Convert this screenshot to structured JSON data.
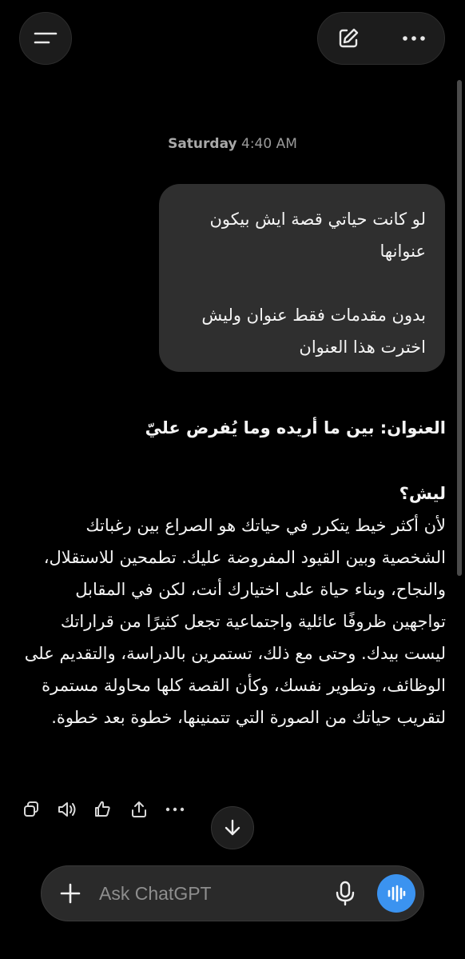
{
  "header": {
    "menu_icon": "menu-icon",
    "new_chat_icon": "new-chat-icon",
    "more_icon": "more-icon"
  },
  "conversation": {
    "timestamp_day": "Saturday",
    "timestamp_time": "4:40 AM",
    "user_message": {
      "paragraph_1": "لو كانت حياتي قصة ايش بيكون عنوانها",
      "paragraph_2": "بدون مقدمات فقط عنوان وليش اخترت هذا العنوان"
    },
    "assistant_message": {
      "title_line": "العنوان: بين ما أريده وما يُفرض عليّ",
      "why_heading": "ليش؟",
      "body": "لأن أكثر خيط يتكرر في حياتك هو الصراع بين رغباتك الشخصية وبين القيود المفروضة عليك. تطمحين للاستقلال، والنجاح، وبناء حياة على اختيارك أنت، لكن في المقابل تواجهين ظروفًا عائلية واجتماعية تجعل كثيرًا من قراراتك ليست بيدك. وحتى مع ذلك، تستمرين بالدراسة، والتقديم على الوظائف، وتطوير نفسك، وكأن القصة كلها محاولة مستمرة لتقريب حياتك من الصورة التي تتمنينها، خطوة بعد خطوة."
    },
    "message_actions": [
      "copy-icon",
      "read-aloud-icon",
      "feedback-icon",
      "share-icon",
      "more-icon"
    ]
  },
  "composer": {
    "placeholder": "Ask ChatGPT",
    "value": "",
    "icons": [
      "plus-icon",
      "microphone-icon",
      "voice-mode-icon"
    ]
  },
  "colors": {
    "background": "#000000",
    "bubble": "#2f2f2f",
    "accent": "#3b93f0"
  }
}
